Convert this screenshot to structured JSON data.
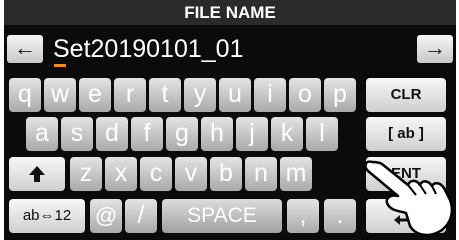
{
  "title": "FILE NAME",
  "entry": {
    "text": "Set20190101_01"
  },
  "nav": {
    "left_arrow": "←",
    "right_arrow": "→"
  },
  "keyboard": {
    "row1": [
      "q",
      "w",
      "e",
      "r",
      "t",
      "y",
      "u",
      "i",
      "o",
      "p"
    ],
    "row2": [
      "a",
      "s",
      "d",
      "f",
      "g",
      "h",
      "j",
      "k",
      "l"
    ],
    "row3": [
      "z",
      "x",
      "c",
      "v",
      "b",
      "n",
      "m"
    ],
    "row4": {
      "mode": "ab⇔12",
      "at": "@",
      "slash": "/",
      "space": "SPACE",
      "comma": ",",
      "period": "."
    },
    "shift": "shift-up-icon",
    "functions": {
      "clear": "CLR",
      "case": "[ ab ]",
      "enter": "ENT",
      "back": "back-icon"
    }
  },
  "colors": {
    "cursor": "#f08a1a",
    "background": "#0b0b0b",
    "title_bar": "#2a2a2a"
  }
}
